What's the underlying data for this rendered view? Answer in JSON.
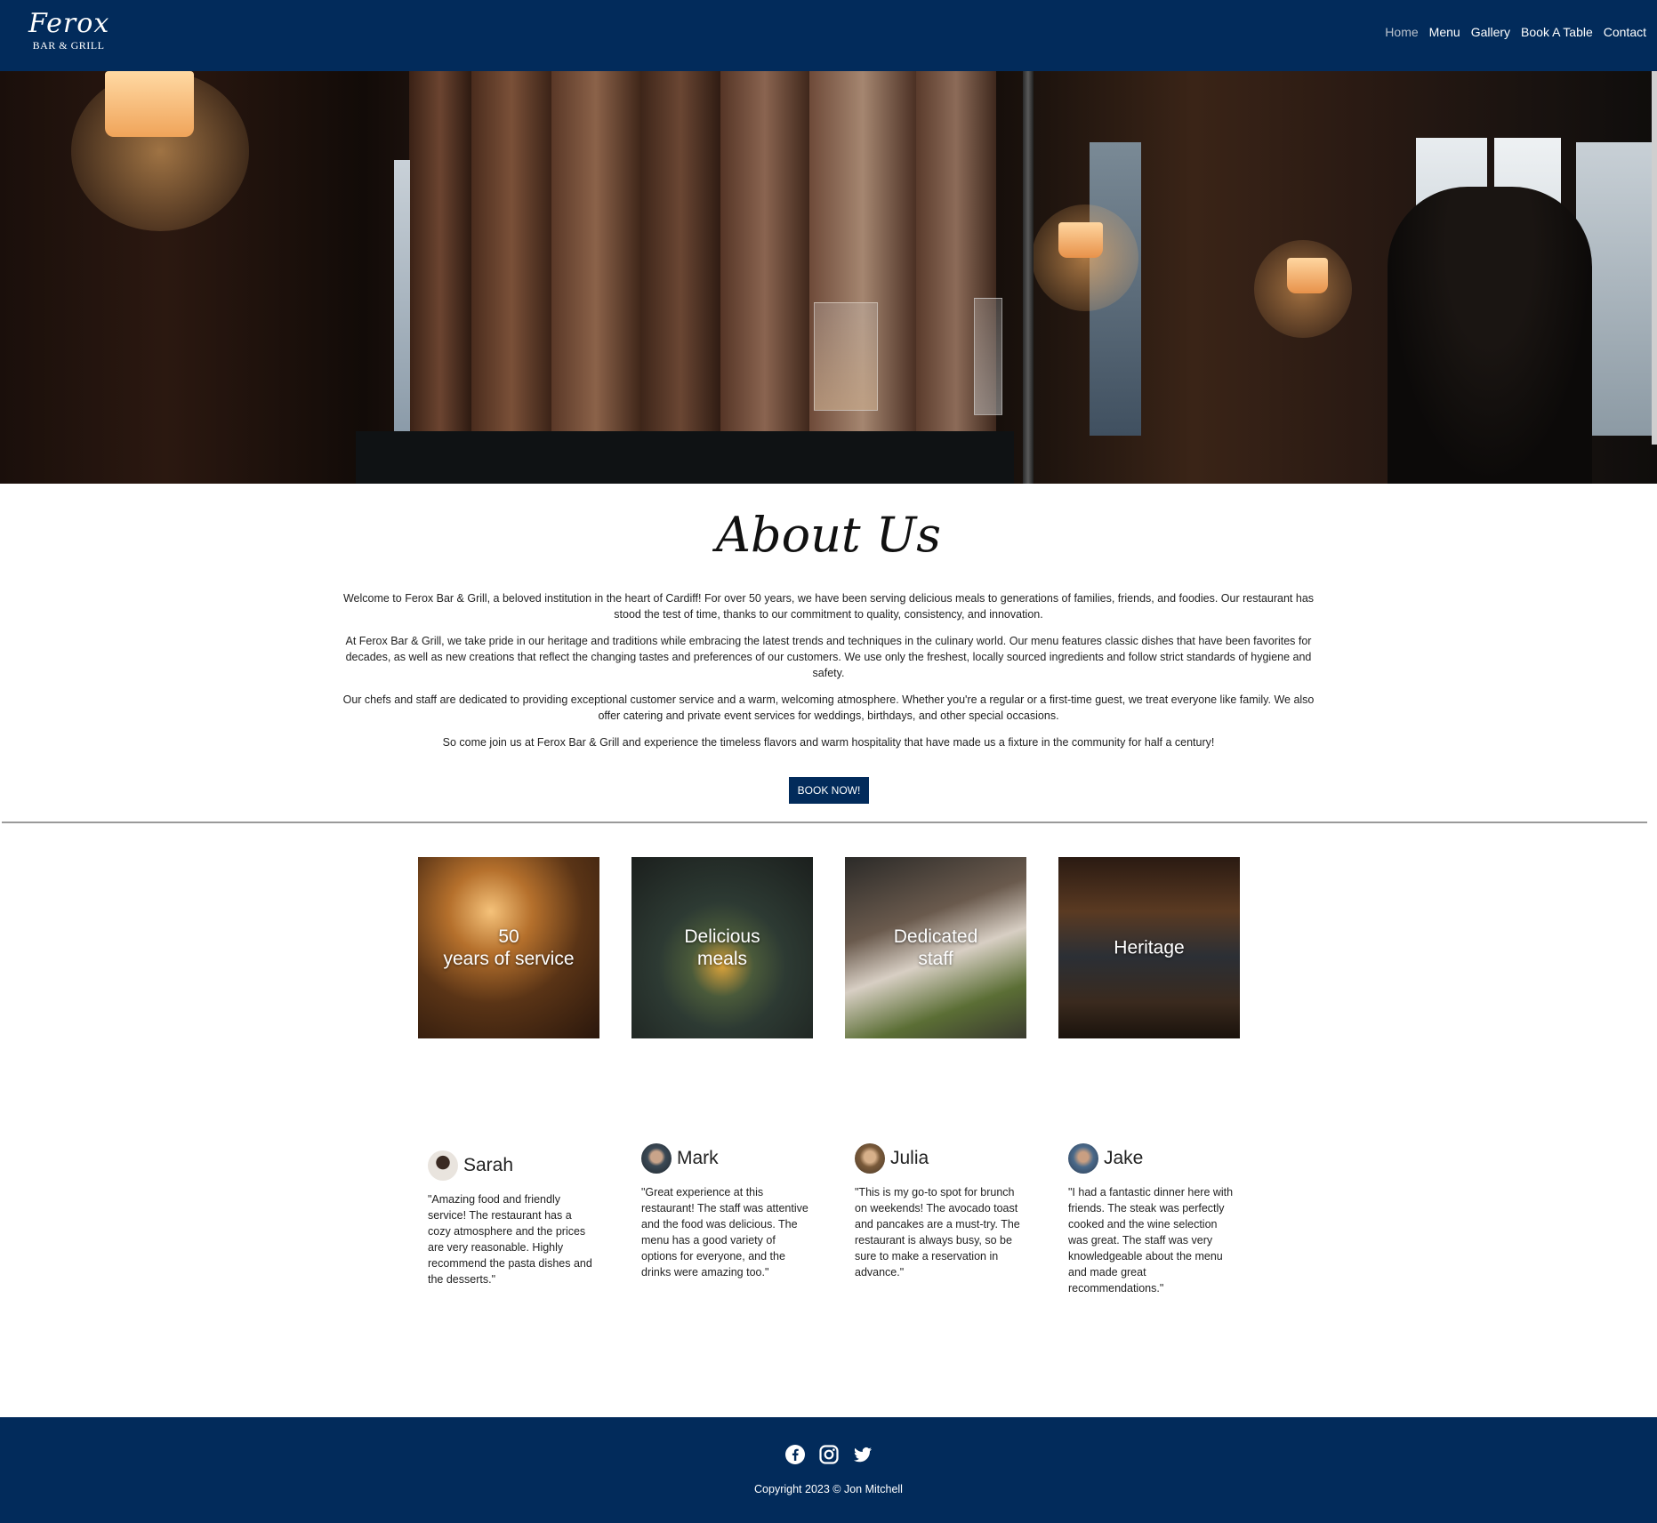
{
  "nav": {
    "logo_script": "Ferox",
    "logo_sub": "BAR & GRILL",
    "links": [
      {
        "label": "Home",
        "active": true
      },
      {
        "label": "Menu"
      },
      {
        "label": "Gallery"
      },
      {
        "label": "Book A Table"
      },
      {
        "label": "Contact"
      }
    ]
  },
  "about": {
    "title": "About Us",
    "paragraphs": [
      "Welcome to Ferox Bar & Grill, a beloved institution in the heart of Cardiff! For over 50 years, we have been serving delicious meals to generations of families, friends, and foodies. Our restaurant has stood the test of time, thanks to our commitment to quality, consistency, and innovation.",
      "At Ferox Bar & Grill, we take pride in our heritage and traditions while embracing the latest trends and techniques in the culinary world. Our menu features classic dishes that have been favorites for decades, as well as new creations that reflect the changing tastes and preferences of our customers. We use only the freshest, locally sourced ingredients and follow strict standards of hygiene and safety.",
      "Our chefs and staff are dedicated to providing exceptional customer service and a warm, welcoming atmosphere. Whether you're a regular or a first-time guest, we treat everyone like family. We also offer catering and private event services for weddings, birthdays, and other special occasions.",
      "So come join us at Ferox Bar & Grill and experience the timeless flavors and warm hospitality that have made us a fixture in the community for half a century!"
    ],
    "button": "BOOK NOW!"
  },
  "features": [
    {
      "line1": "50",
      "line2": "years of service"
    },
    {
      "line1": "Delicious",
      "line2": "meals"
    },
    {
      "line1": "Dedicated",
      "line2": "staff"
    },
    {
      "line1": "Heritage",
      "line2": ""
    }
  ],
  "reviews": [
    {
      "name": "Sarah",
      "text": "\"Amazing food and friendly service! The restaurant has a cozy atmosphere and the prices are very reasonable. Highly recommend the pasta dishes and the desserts.\""
    },
    {
      "name": "Mark",
      "text": "\"Great experience at this restaurant! The staff was attentive and the food was delicious. The menu has a good variety of options for everyone, and the drinks were amazing too.\""
    },
    {
      "name": "Julia",
      "text": "\"This is my go-to spot for brunch on weekends! The avocado toast and pancakes are a must-try. The restaurant is always busy, so be sure to make a reservation in advance.\""
    },
    {
      "name": "Jake",
      "text": "\"I had a fantastic dinner here with friends. The steak was perfectly cooked and the wine selection was great. The staff was very knowledgeable about the menu and made great recommendations.\""
    }
  ],
  "footer": {
    "copyright": "Copyright 2023 © Jon Mitchell",
    "icons": [
      "facebook-icon",
      "instagram-icon",
      "twitter-icon"
    ]
  },
  "colors": {
    "brand": "#022b5b",
    "nav_active": "#b9c1cc"
  }
}
